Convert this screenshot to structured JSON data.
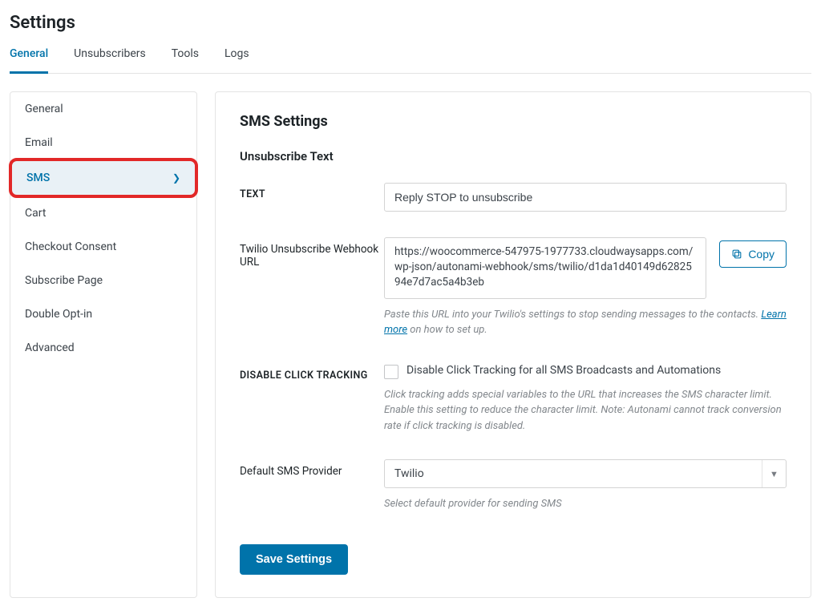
{
  "page_title": "Settings",
  "tabs": {
    "items": [
      {
        "label": "General",
        "active": true
      },
      {
        "label": "Unsubscribers",
        "active": false
      },
      {
        "label": "Tools",
        "active": false
      },
      {
        "label": "Logs",
        "active": false
      }
    ]
  },
  "sidebar": {
    "items": [
      {
        "label": "General"
      },
      {
        "label": "Email"
      },
      {
        "label": "SMS",
        "active": true,
        "highlighted": true
      },
      {
        "label": "Cart"
      },
      {
        "label": "Checkout Consent"
      },
      {
        "label": "Subscribe Page"
      },
      {
        "label": "Double Opt-in"
      },
      {
        "label": "Advanced"
      }
    ]
  },
  "panel": {
    "title": "SMS Settings",
    "sub_title": "Unsubscribe Text",
    "text_field": {
      "label": "TEXT",
      "value": "Reply STOP to unsubscribe"
    },
    "webhook": {
      "label": "Twilio Unsubscribe Webhook URL",
      "value": "https://woocommerce-547975-1977733.cloudwaysapps.com/wp-json/autonami-webhook/sms/twilio/d1da1d40149d6282594e7d7ac5a4b3eb",
      "copy_label": "Copy",
      "help_prefix": "Paste this URL into your Twilio's settings to stop sending messages to the contacts. ",
      "help_link": "Learn more",
      "help_suffix": " on how to set up."
    },
    "disable_tracking": {
      "label": "DISABLE CLICK TRACKING",
      "checkbox_label": "Disable Click Tracking for all SMS Broadcasts and Automations",
      "help": "Click tracking adds special variables to the URL that increases the SMS character limit. Enable this setting to reduce the character limit. Note: Autonami cannot track conversion rate if click tracking is disabled."
    },
    "provider": {
      "label": "Default SMS Provider",
      "value": "Twilio",
      "help": "Select default provider for sending SMS"
    },
    "save_label": "Save Settings"
  }
}
